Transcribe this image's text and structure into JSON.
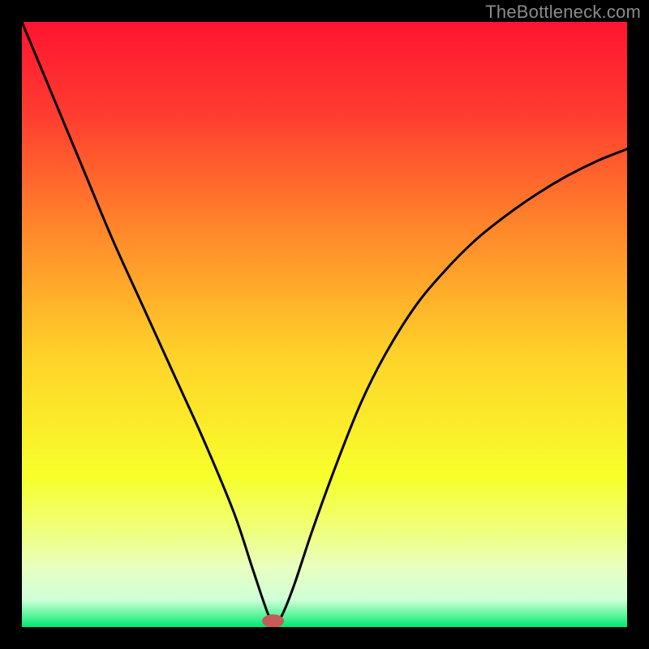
{
  "watermark": "TheBottleneck.com",
  "chart_data": {
    "type": "line",
    "title": "",
    "xlabel": "",
    "ylabel": "",
    "xlim": [
      0,
      100
    ],
    "ylim": [
      0,
      100
    ],
    "grid": false,
    "legend": false,
    "background_gradient": {
      "stops": [
        {
          "offset": 0.0,
          "color": "#ff1430"
        },
        {
          "offset": 0.15,
          "color": "#ff3b30"
        },
        {
          "offset": 0.35,
          "color": "#ff8a2a"
        },
        {
          "offset": 0.55,
          "color": "#ffd22a"
        },
        {
          "offset": 0.75,
          "color": "#f7ff2a"
        },
        {
          "offset": 0.84,
          "color": "#f0ff7b"
        },
        {
          "offset": 0.9,
          "color": "#e9ffbf"
        },
        {
          "offset": 0.955,
          "color": "#cfffd8"
        },
        {
          "offset": 0.985,
          "color": "#45f38f"
        },
        {
          "offset": 1.0,
          "color": "#00e574"
        }
      ]
    },
    "series": [
      {
        "name": "bottleneck-curve",
        "x": [
          0,
          5,
          10,
          15,
          20,
          25,
          30,
          35,
          38,
          40,
          41,
          42,
          43,
          45,
          48,
          52,
          56,
          60,
          65,
          70,
          75,
          80,
          85,
          90,
          95,
          100
        ],
        "y": [
          100,
          88,
          76,
          64,
          53,
          42,
          31,
          19,
          10,
          4,
          1.5,
          1,
          2,
          7,
          16,
          27,
          37,
          45,
          53,
          59,
          64,
          68,
          71.5,
          74.5,
          77,
          79
        ]
      }
    ],
    "marker": {
      "name": "current-point",
      "x": 41.5,
      "y": 1.0,
      "color": "#c85a57",
      "rx": 1.8,
      "ry": 1.1
    }
  }
}
